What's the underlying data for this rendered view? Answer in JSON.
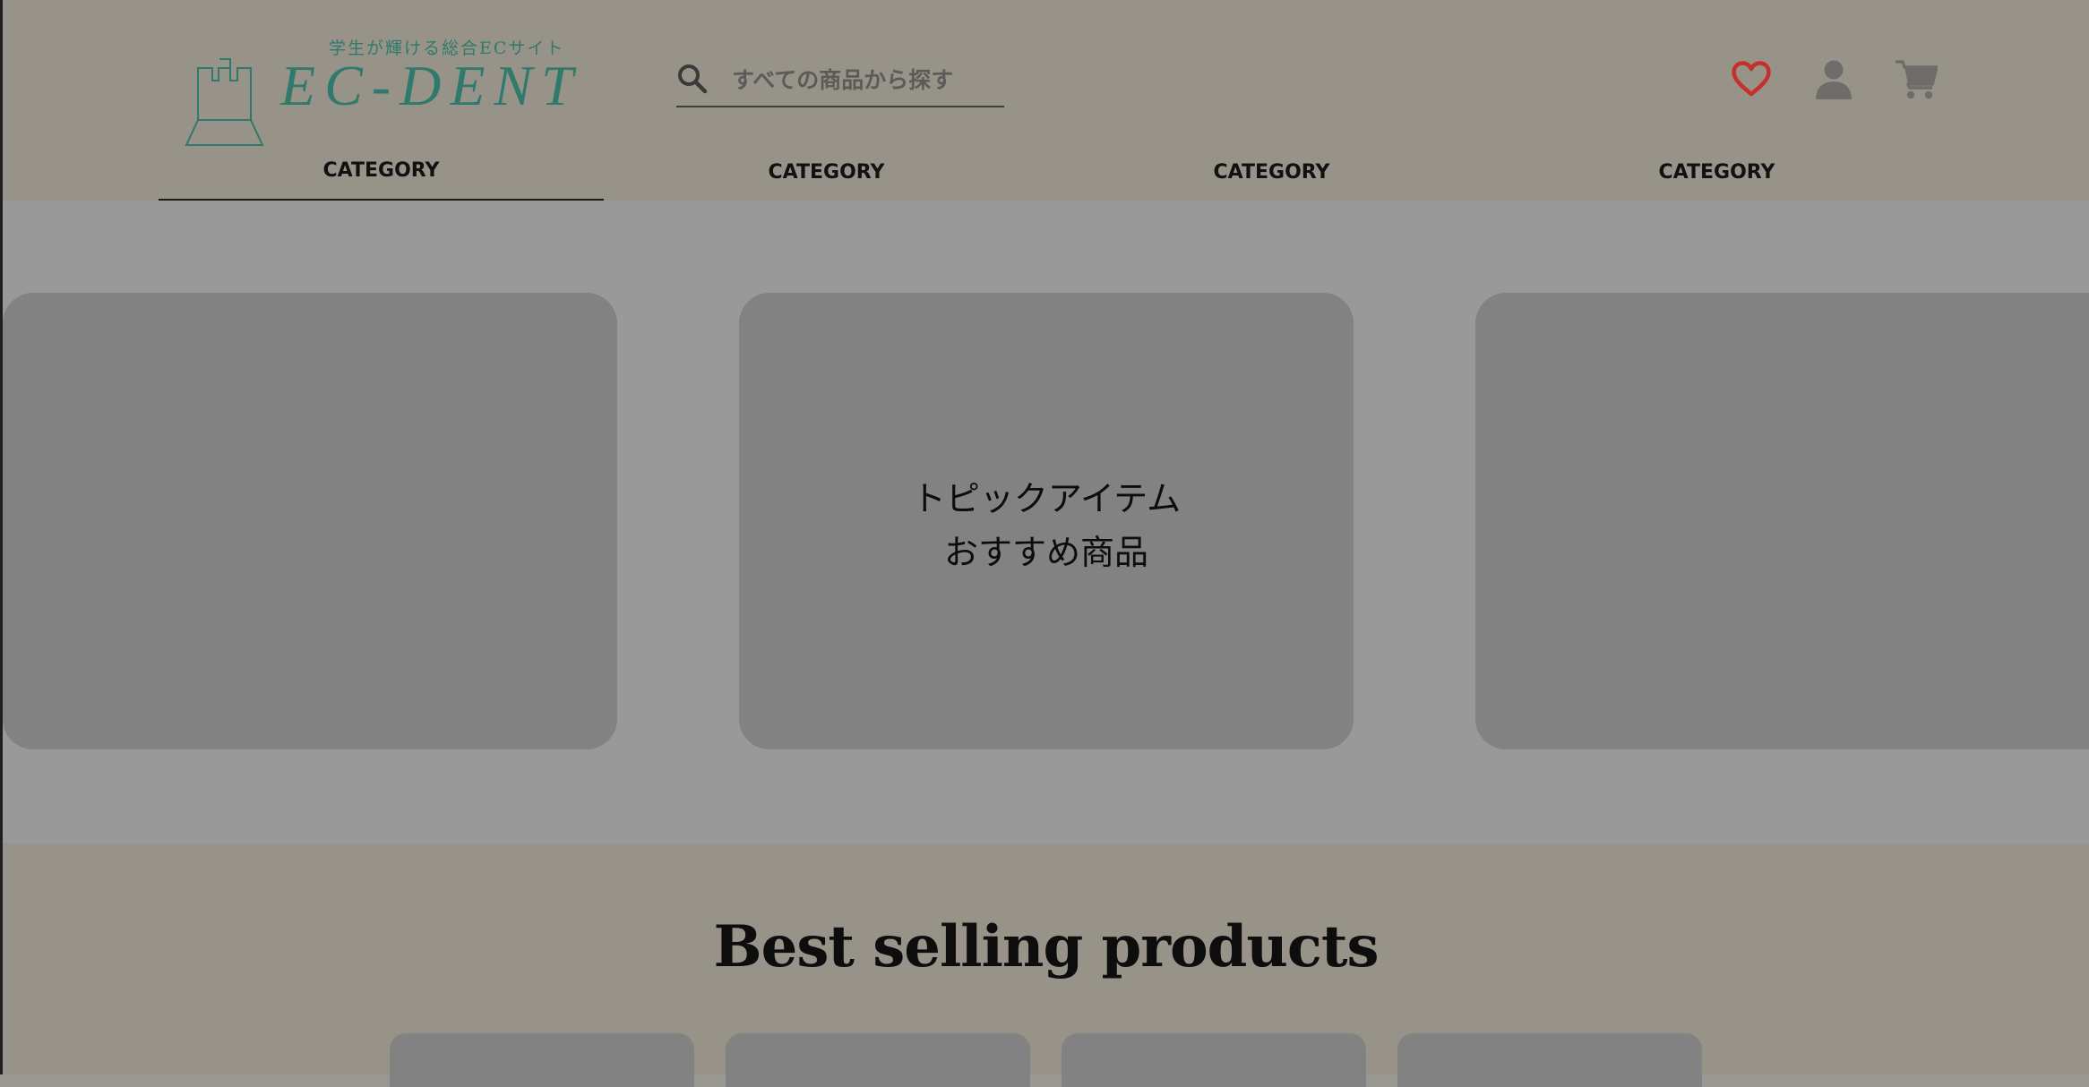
{
  "header": {
    "logo": {
      "tagline": "学生が輝ける総合ECサイト",
      "wordmark": "EC-DENT"
    },
    "search": {
      "placeholder": "すべての商品から探す",
      "icon": "search-icon"
    },
    "actions": [
      {
        "name": "favorites",
        "icon": "heart-icon",
        "color": "#c4302b"
      },
      {
        "name": "account",
        "icon": "user-icon",
        "color": "#6f6d69"
      },
      {
        "name": "cart",
        "icon": "cart-icon",
        "color": "#6f6d69"
      }
    ]
  },
  "nav": {
    "tabs": [
      {
        "label": "CATEGORY",
        "active": true
      },
      {
        "label": "CATEGORY",
        "active": false
      },
      {
        "label": "CATEGORY",
        "active": false
      },
      {
        "label": "CATEGORY",
        "active": false
      }
    ]
  },
  "carousel": {
    "center": {
      "line1": "トピックアイテム",
      "line2": "おすすめ商品"
    }
  },
  "best_selling": {
    "title": "Best selling products"
  },
  "colors": {
    "header_bg": "#979389",
    "carousel_bg": "#999999",
    "card_bg": "#828282",
    "brand": "#2f7a6d",
    "heart": "#c4302b"
  }
}
